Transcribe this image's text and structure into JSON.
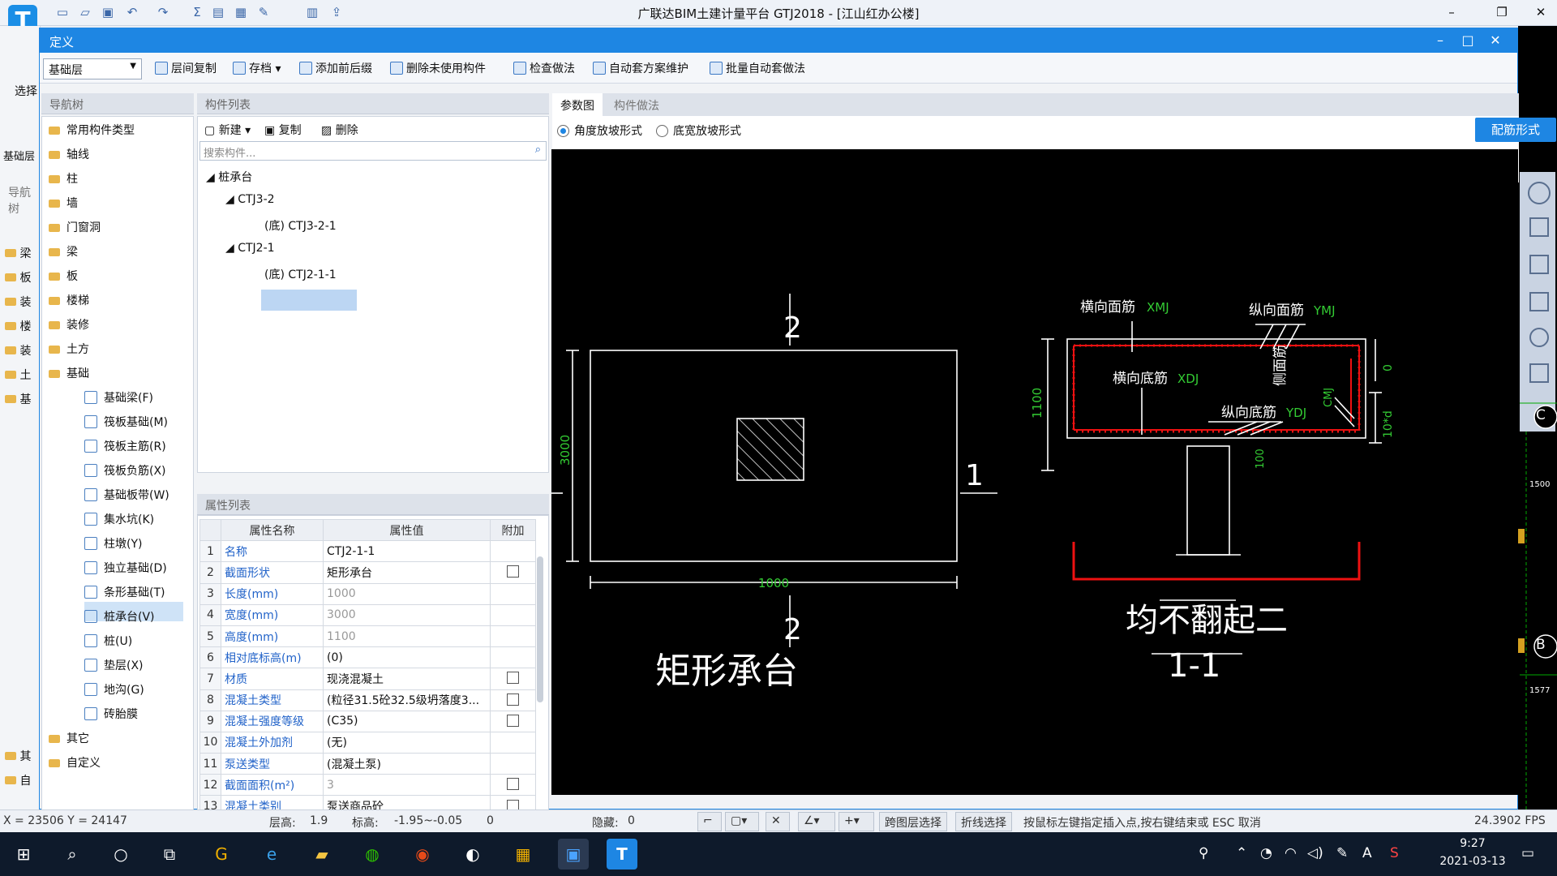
{
  "app": {
    "title": "广联达BIM土建计量平台 GTJ2018 - [江山红办公楼]",
    "logo_letter": "T"
  },
  "quick_access": {
    "icons": [
      "new-file-icon",
      "open-folder-icon",
      "save-icon",
      "undo-icon",
      "redo-icon",
      "sum-icon",
      "table-icon",
      "report-icon",
      "brush-icon",
      "grid-icon",
      "export-icon"
    ]
  },
  "background": {
    "select_label": "选择",
    "floor_label": "基础层",
    "nav_label": "导航树",
    "items": [
      "梁",
      "板",
      "装",
      "楼",
      "装",
      "土",
      "基"
    ],
    "bottom_items": [
      "其",
      "自"
    ]
  },
  "dialog": {
    "title": "定义"
  },
  "toolbar": {
    "floor_value": "基础层",
    "buttons": [
      "层间复制",
      "存档",
      "添加前后缀",
      "删除未使用构件",
      "检查做法",
      "自动套方案维护",
      "批量自动套做法"
    ]
  },
  "nav": {
    "header": "导航树",
    "items": [
      "常用构件类型",
      "轴线",
      "柱",
      "墙",
      "门窗洞",
      "梁",
      "板",
      "楼梯",
      "装修",
      "土方",
      "基础"
    ],
    "sub_items": [
      "基础梁(F)",
      "筏板基础(M)",
      "筏板主筋(R)",
      "筏板负筋(X)",
      "基础板带(W)",
      "集水坑(K)",
      "柱墩(Y)",
      "独立基础(D)",
      "条形基础(T)",
      "桩承台(V)",
      "桩(U)",
      "垫层(X)",
      "地沟(G)",
      "砖胎膜"
    ],
    "tail_items": [
      "其它",
      "自定义"
    ],
    "selected": "桩承台(V)"
  },
  "components": {
    "header": "构件列表",
    "new_label": "新建",
    "copy_label": "复制",
    "delete_label": "删除",
    "search_placeholder": "搜索构件...",
    "tree": {
      "root": "桩承台",
      "groups": [
        {
          "name": "CTJ3-2",
          "child": "(底) CTJ3-2-1"
        },
        {
          "name": "CTJ2-1",
          "child": "(底) CTJ2-1-1"
        }
      ]
    }
  },
  "props": {
    "header": "属性列表",
    "columns": [
      "属性名称",
      "属性值",
      "附加"
    ],
    "rows": [
      {
        "n": "1",
        "k": "名称",
        "v": "CTJ2-1-1",
        "cb": false,
        "gray": false
      },
      {
        "n": "2",
        "k": "截面形状",
        "v": "矩形承台",
        "cb": true,
        "gray": false
      },
      {
        "n": "3",
        "k": "长度(mm)",
        "v": "1000",
        "cb": false,
        "gray": true
      },
      {
        "n": "4",
        "k": "宽度(mm)",
        "v": "3000",
        "cb": false,
        "gray": true
      },
      {
        "n": "5",
        "k": "高度(mm)",
        "v": "1100",
        "cb": false,
        "gray": true
      },
      {
        "n": "6",
        "k": "相对底标高(m)",
        "v": "(0)",
        "cb": false,
        "gray": false
      },
      {
        "n": "7",
        "k": "材质",
        "v": "现浇混凝土",
        "cb": true,
        "gray": false
      },
      {
        "n": "8",
        "k": "混凝土类型",
        "v": "(粒径31.5砼32.5级坍落度3...",
        "cb": true,
        "gray": false
      },
      {
        "n": "9",
        "k": "混凝土强度等级",
        "v": "(C35)",
        "cb": true,
        "gray": false
      },
      {
        "n": "10",
        "k": "混凝土外加剂",
        "v": "(无)",
        "cb": false,
        "gray": false
      },
      {
        "n": "11",
        "k": "泵送类型",
        "v": "(混凝土泵)",
        "cb": false,
        "gray": false
      },
      {
        "n": "12",
        "k": "截面面积(m²)",
        "v": "3",
        "cb": true,
        "gray": true
      },
      {
        "n": "13",
        "k": "混凝土类别",
        "v": "泵送商品砼",
        "cb": true,
        "gray": false
      }
    ]
  },
  "param": {
    "tabs": [
      "参数图",
      "构件做法"
    ],
    "radio_angle": "角度放坡形式",
    "radio_width": "底宽放坡形式",
    "peijin_button": "配筋形式"
  },
  "drawing": {
    "plan_title": "矩形承台",
    "section_num_top": "2",
    "section_num_bottom": "2",
    "section_num_right": "1",
    "dim_width": "1000",
    "dim_height": "3000",
    "label_xmj": "横向面筋",
    "code_xmj": "XMJ",
    "label_ymj": "纵向面筋",
    "code_ymj": "YMJ",
    "label_xdj": "横向底筋",
    "code_xdj": "XDJ",
    "label_ydj": "纵向底筋",
    "code_ydj": "YDJ",
    "label_cmj": "侧面筋",
    "code_cmj": "CMJ",
    "dim_1100": "1100",
    "dim_0": "0",
    "dim_10d": "10*d",
    "dim_100": "100",
    "section_title": "均不翻起二",
    "section_sub": "1-1"
  },
  "right_strip": {
    "axis_c": "C",
    "axis_b": "B",
    "dim_1500": "1500",
    "dim_1577": "1577"
  },
  "status": {
    "coords": "X = 23506 Y = 24147",
    "floor_height_label": "层高:",
    "floor_height": "1.9",
    "elev_label": "标高:",
    "elev": "-1.95~-0.05",
    "count": "0",
    "hidden_label": "隐藏:",
    "hidden": "0",
    "cross_layer": "跨图层选择",
    "polyline": "折线选择",
    "hint": "按鼠标左键指定插入点,按右键结束或 ESC 取消",
    "fps": "24.3902 FPS"
  },
  "taskbar": {
    "time": "9:27",
    "date": "2021-03-13",
    "ime": "A"
  }
}
